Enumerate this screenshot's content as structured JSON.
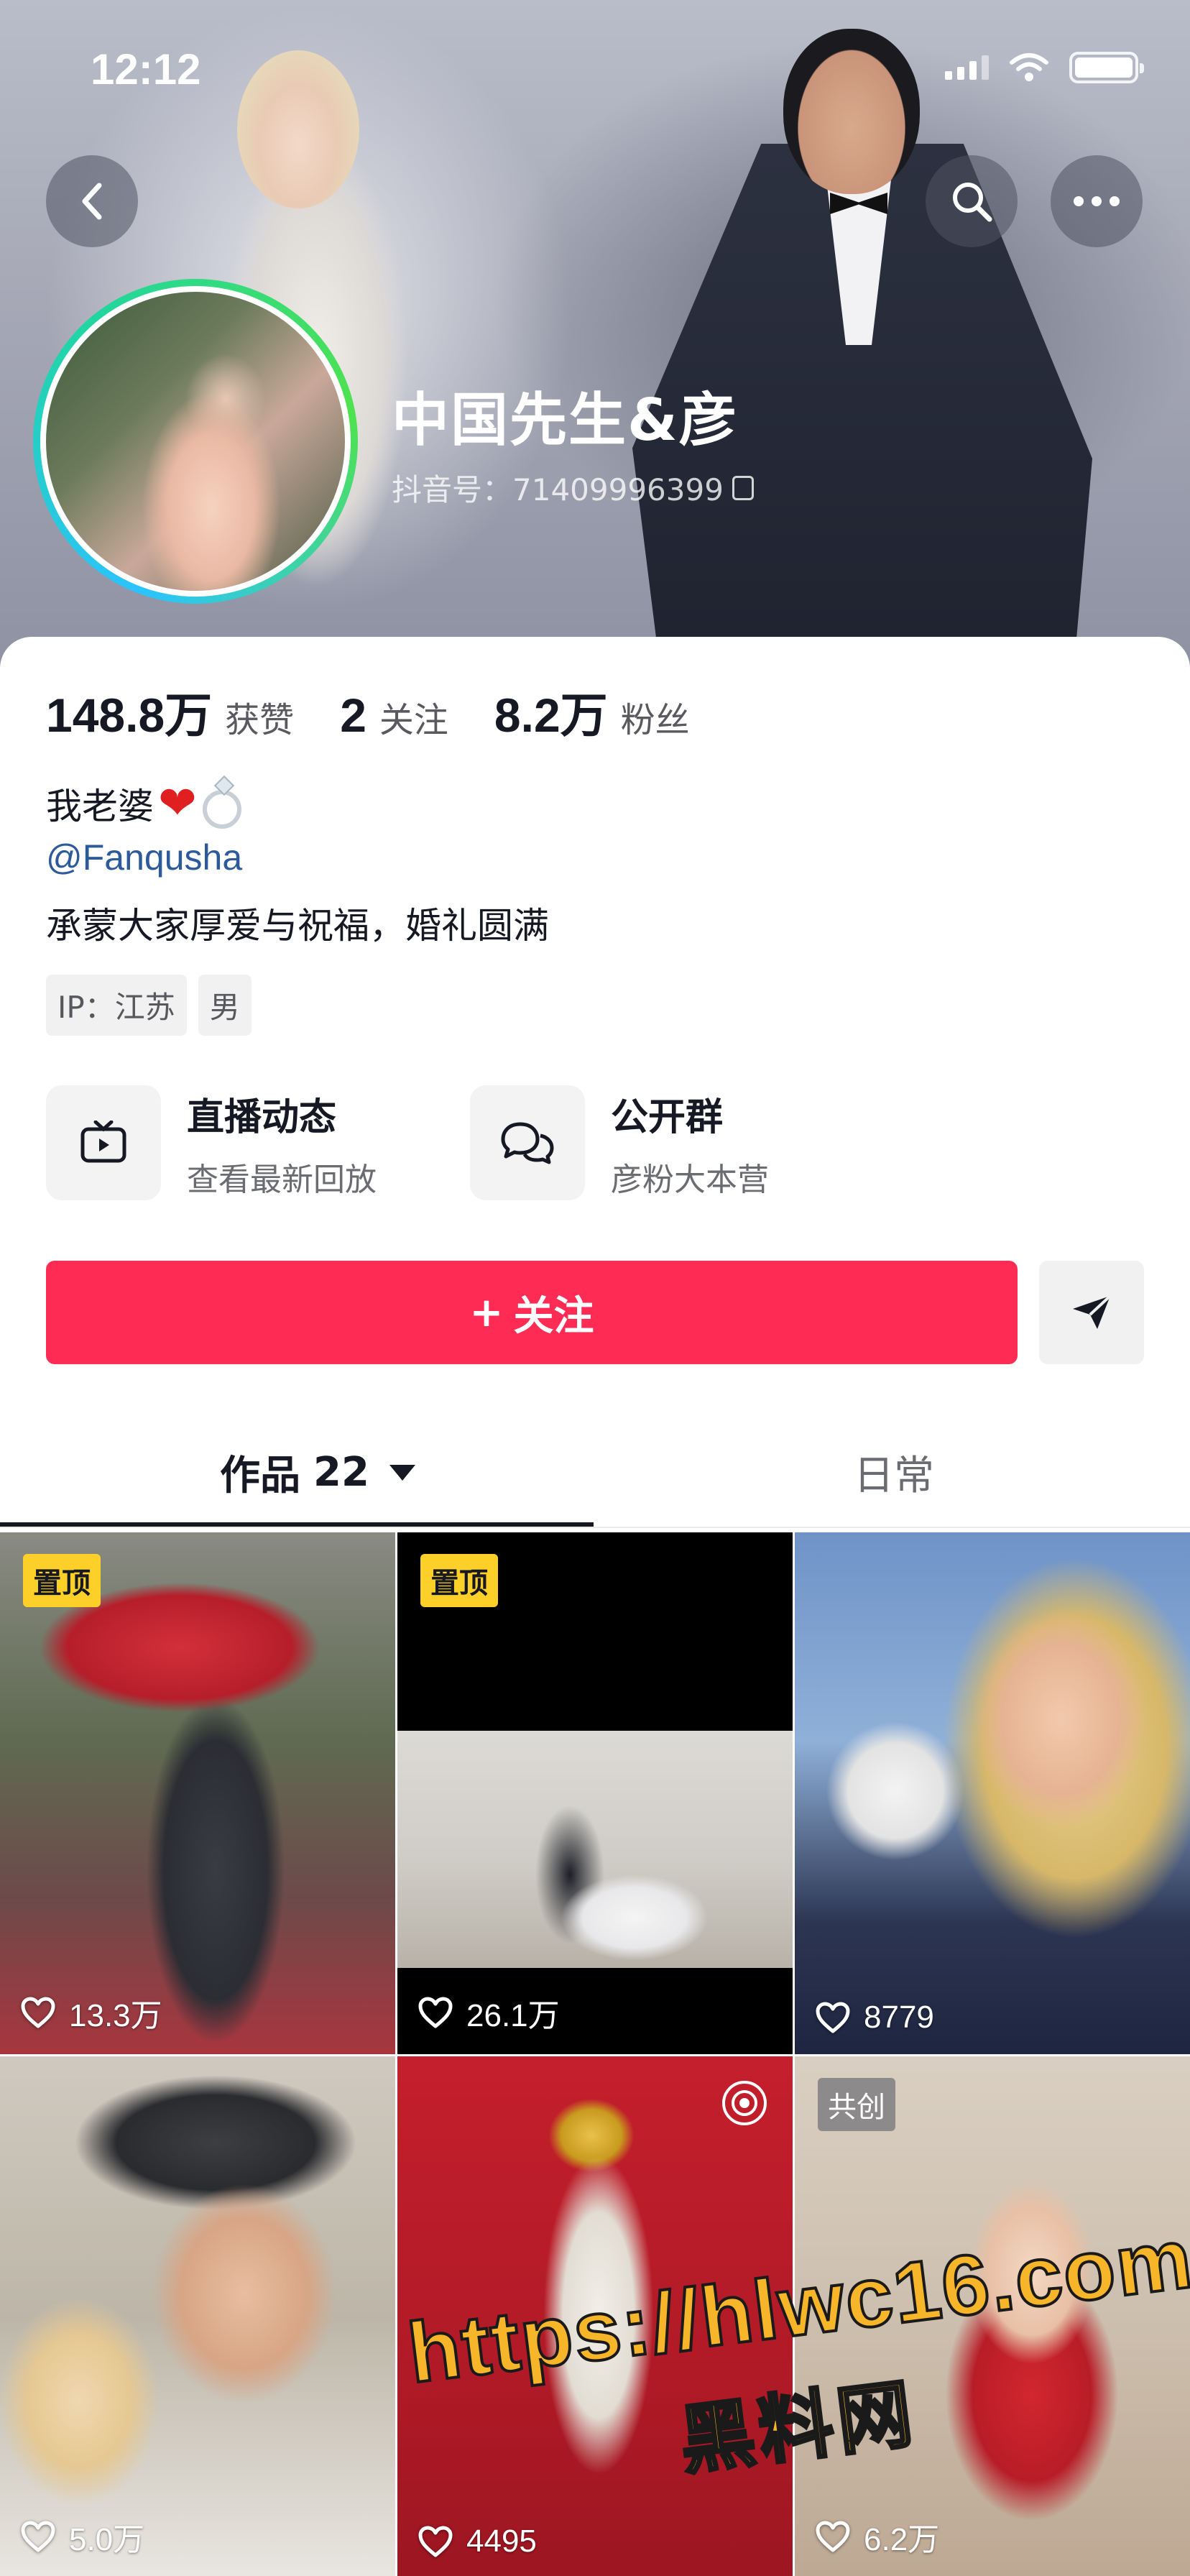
{
  "status_bar": {
    "time": "12:12"
  },
  "profile": {
    "nickname": "中国先生&彦",
    "account_id": "抖音号：71409996399",
    "stats": [
      {
        "value": "148.8万",
        "label": "获赞"
      },
      {
        "value": "2",
        "label": "关注"
      },
      {
        "value": "8.2万",
        "label": "粉丝"
      }
    ],
    "bio_line1": "我老婆",
    "mention": "@Fanqusha",
    "bio_line2": "承蒙大家厚爱与祝福，婚礼圆满",
    "tags": [
      "IP：江苏",
      "男"
    ]
  },
  "features": [
    {
      "title": "直播动态",
      "subtitle": "查看最新回放",
      "icon": "tv-icon"
    },
    {
      "title": "公开群",
      "subtitle": "彦粉大本营",
      "icon": "chat-bubbles-icon"
    }
  ],
  "actions": {
    "follow_label": "关注",
    "follow_plus": "+"
  },
  "tabs": {
    "works_label": "作品",
    "works_count": "22",
    "daily_label": "日常"
  },
  "videos": [
    {
      "likes": "13.3万",
      "badge": "置顶"
    },
    {
      "likes": "26.1万",
      "badge": "置顶"
    },
    {
      "likes": "8779"
    },
    {
      "likes": "5.0万"
    },
    {
      "likes": "4495",
      "live_replay": true
    },
    {
      "likes": "6.2万",
      "badge": "共创"
    }
  ],
  "watermark": {
    "url": "https://hlwc16.com",
    "name": "黑料网"
  },
  "colors": {
    "accent": "#fe2c55",
    "pin_badge": "#fccf29",
    "mention": "#2d5a9b",
    "watermark": "#f7b52a"
  }
}
